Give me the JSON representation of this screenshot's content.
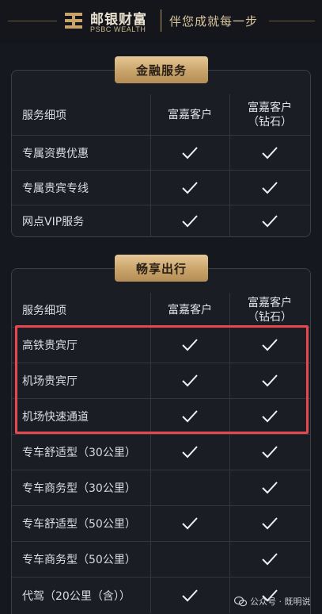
{
  "header": {
    "brand_cn": "邮银财富",
    "brand_en": "PSBC WEALTH",
    "slogan": "伴您成就每一步"
  },
  "section1": {
    "title": "金融服务",
    "columns": [
      "服务细项",
      "富嘉客户",
      "富嘉客户\n（钻石）"
    ],
    "rows": [
      {
        "label": "专属资费优惠",
        "c2": true,
        "c3": true
      },
      {
        "label": "专属贵宾专线",
        "c2": true,
        "c3": true
      },
      {
        "label": "网点VIP服务",
        "c2": true,
        "c3": true
      }
    ]
  },
  "section2": {
    "title": "畅享出行",
    "columns": [
      "服务细项",
      "富嘉客户",
      "富嘉客户\n（钻石）"
    ],
    "rows": [
      {
        "label": "高铁贵宾厅",
        "c2": true,
        "c3": true
      },
      {
        "label": "机场贵宾厅",
        "c2": true,
        "c3": true
      },
      {
        "label": "机场快速通道",
        "c2": true,
        "c3": true
      },
      {
        "label": "专车舒适型（30公里）",
        "c2": true,
        "c3": true
      },
      {
        "label": "专车商务型（30公里）",
        "c2": false,
        "c3": true
      },
      {
        "label": "专车舒适型（50公里）",
        "c2": true,
        "c3": true
      },
      {
        "label": "专车商务型（50公里）",
        "c2": false,
        "c3": true
      },
      {
        "label": "代驾（20公里（含））",
        "c2": true,
        "c3": true
      }
    ]
  },
  "watermark": "公众号 · 既明说",
  "colors": {
    "background": "#161820",
    "gold": "#c9a46a",
    "highlight": "#e5484d"
  }
}
